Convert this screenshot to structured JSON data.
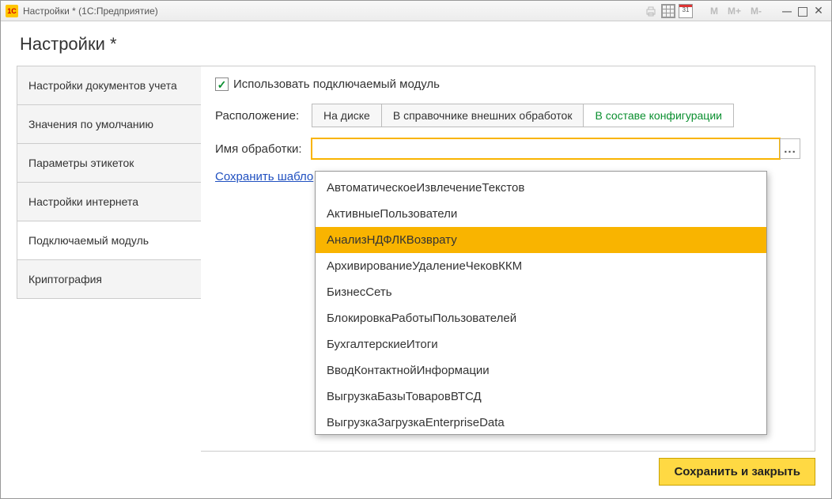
{
  "titlebar": {
    "app_icon_text": "1C",
    "title": "Настройки * (1С:Предприятие)",
    "calendar_day": "31"
  },
  "page_title": "Настройки *",
  "sidebar": {
    "items": [
      {
        "label": "Настройки документов учета",
        "active": false
      },
      {
        "label": "Значения по умолчанию",
        "active": false
      },
      {
        "label": "Параметры этикеток",
        "active": false
      },
      {
        "label": "Настройки интернета",
        "active": false
      },
      {
        "label": "Подключаемый модуль",
        "active": true
      },
      {
        "label": "Криптография",
        "active": false
      }
    ]
  },
  "panel": {
    "use_module_label": "Использовать подключаемый модуль",
    "use_module_checked": true,
    "location_label": "Расположение:",
    "location_tabs": [
      {
        "label": "На диске",
        "active": false
      },
      {
        "label": "В справочнике внешних обработок",
        "active": false
      },
      {
        "label": "В составе конфигурации",
        "active": true
      }
    ],
    "processing_name_label": "Имя обработки:",
    "processing_name_value": "",
    "more_btn": "...",
    "save_template_link": "Сохранить шабло"
  },
  "dropdown": {
    "highlighted_index": 2,
    "items": [
      "АвтоматическоеИзвлечениеТекстов",
      "АктивныеПользователи",
      "АнализНДФЛКВозврату",
      "АрхивированиеУдалениеЧековККМ",
      "БизнесСеть",
      "БлокировкаРаботыПользователей",
      "БухгалтерскиеИтоги",
      "ВводКонтактнойИнформации",
      "ВыгрузкаБазыТоваровВТСД",
      "ВыгрузкаЗагрузкаEnterpriseData"
    ]
  },
  "footer": {
    "save_close": "Сохранить и закрыть"
  }
}
